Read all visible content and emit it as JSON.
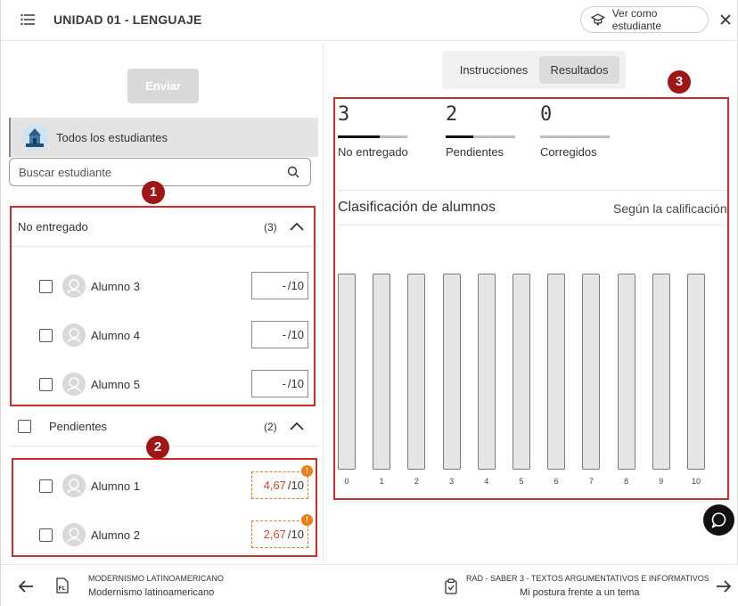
{
  "header": {
    "title": "UNIDAD 01 - LENGUAJE",
    "view_as_student": "Ver como estudiante",
    "icons": [
      "menu-icon",
      "graduation-cap-icon",
      "close-icon"
    ]
  },
  "left_panel": {
    "send_button": "Enviar",
    "all_students": "Todos los estudiantes",
    "search_placeholder": "Buscar estudiante",
    "sections": [
      {
        "title": "No entregado",
        "count": "(3)",
        "students": [
          {
            "name": "Alumno 3",
            "grade": "-",
            "max": "/10"
          },
          {
            "name": "Alumno 4",
            "grade": "-",
            "max": "/10"
          },
          {
            "name": "Alumno 5",
            "grade": "-",
            "max": "/10"
          }
        ]
      },
      {
        "title": "Pendientes",
        "count": "(2)",
        "students": [
          {
            "name": "Alumno 1",
            "grade": "4,67",
            "max": "/10",
            "warning": "!"
          },
          {
            "name": "Alumno 2",
            "grade": "2,67",
            "max": "/10",
            "warning": "!"
          }
        ]
      }
    ]
  },
  "right_panel": {
    "tabs": [
      "Instrucciones",
      "Resultados"
    ],
    "active_tab": "Resultados",
    "stats": [
      {
        "value": "3",
        "label": "No entregado",
        "progress": 0.6
      },
      {
        "value": "2",
        "label": "Pendientes",
        "progress": 0.4
      },
      {
        "value": "0",
        "label": "Corregidos",
        "progress": 0.0
      }
    ],
    "classification_title": "Clasificación de alumnos",
    "classification_sort": "Según la calificación"
  },
  "chart_data": {
    "type": "bar",
    "categories": [
      "0",
      "1",
      "2",
      "3",
      "4",
      "5",
      "6",
      "7",
      "8",
      "9",
      "10"
    ],
    "values": [
      0,
      0,
      0,
      0,
      0,
      0,
      0,
      0,
      0,
      0,
      0
    ]
  },
  "annotations": [
    "1",
    "2",
    "3"
  ],
  "footer": {
    "prev_caption": "MODERNISMO LATINOAMERICANO",
    "prev_name": "Modernismo latinoamericano",
    "next_caption": "RAD - SABER 3 - TEXTOS ARGUMENTATIVOS E INFORMATIVOS",
    "next_name": "Mi postura frente a un tema"
  },
  "colors": {
    "accent_red": "#d42a2a",
    "badge": "#a01515",
    "warning": "#ef7d14",
    "grade_alert": "#d44a2e"
  }
}
